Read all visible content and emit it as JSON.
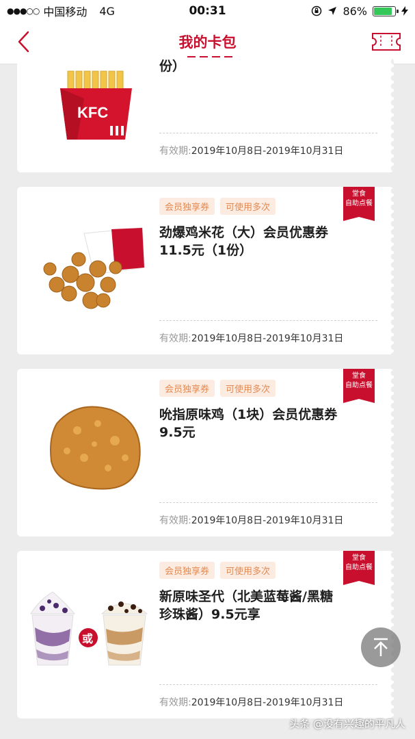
{
  "status_bar": {
    "carrier": "中国移动",
    "network": "4G",
    "time": "00:31",
    "battery_percent": "86%",
    "battery_level": 0.86
  },
  "nav": {
    "title": "我的卡包",
    "back_icon": "chevron-left-icon",
    "right_icon": "ticket-icon"
  },
  "coupons": [
    {
      "title": "份）",
      "validity_label": "有效期:",
      "validity_range": "2019年10月8日-2019年10月31日",
      "image": "fries-icon"
    },
    {
      "tags": [
        "会员独享券",
        "可使用多次"
      ],
      "badge_line1": "堂食",
      "badge_line2": "自助点餐",
      "title_line1": "劲爆鸡米花（大）会员优惠券",
      "title_line2": "11.5元（1份）",
      "validity_label": "有效期:",
      "validity_range": "2019年10月8日-2019年10月31日",
      "image": "popcorn-chicken-icon"
    },
    {
      "tags": [
        "会员独享券",
        "可使用多次"
      ],
      "badge_line1": "堂食",
      "badge_line2": "自助点餐",
      "title_line1": "吮指原味鸡（1块）会员优惠券",
      "title_line2": "9.5元",
      "validity_label": "有效期:",
      "validity_range": "2019年10月8日-2019年10月31日",
      "image": "fried-chicken-icon"
    },
    {
      "tags": [
        "会员独享券",
        "可使用多次"
      ],
      "badge_line1": "堂食",
      "badge_line2": "自助点餐",
      "title_line1": "新原味圣代（北美蓝莓酱/黑糖",
      "title_line2": "珍珠酱）9.5元享",
      "or_label": "或",
      "validity_label": "有效期:",
      "validity_range": "2019年10月8日-2019年10月31日",
      "image": "sundae-icon"
    }
  ],
  "watermark": "头条 @没有兴趣的平凡人",
  "colors": {
    "brand_red": "#c8102e",
    "tag_bg": "#fcebe0",
    "tag_text": "#e38a53",
    "page_bg": "#ececec"
  }
}
